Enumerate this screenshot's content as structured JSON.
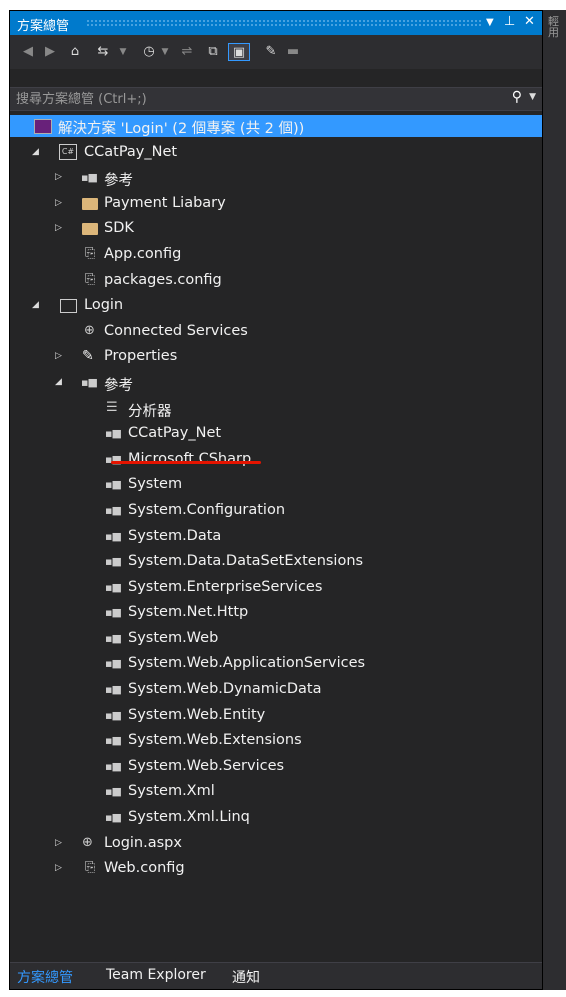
{
  "window": {
    "title": "方案總管"
  },
  "toolbar": {
    "icons": [
      "back-icon",
      "forward-icon",
      "home-icon",
      "sync-icon",
      "dropdown-icon",
      "history-icon",
      "dropdown-icon",
      "switch-view-icon",
      "collapse-all-icon",
      "show-all-files-icon",
      "properties-icon",
      "preview-icon"
    ]
  },
  "search": {
    "placeholder": "搜尋方案總管 (Ctrl+;)"
  },
  "right_strip": {
    "text": "輕用"
  },
  "tree": {
    "solution": "解決方案 'Login' (2 個專案 (共 2 個))",
    "items": [
      {
        "label": "CCatPay_Net"
      },
      {
        "label": "參考"
      },
      {
        "label": "Payment Liabary"
      },
      {
        "label": "SDK"
      },
      {
        "label": "App.config"
      },
      {
        "label": "packages.config"
      },
      {
        "label": "Login"
      },
      {
        "label": "Connected Services"
      },
      {
        "label": "Properties"
      },
      {
        "label": "參考"
      },
      {
        "label": "分析器"
      },
      {
        "label": "CCatPay_Net"
      },
      {
        "label": "Microsoft.CSharp"
      },
      {
        "label": "System"
      },
      {
        "label": "System.Configuration"
      },
      {
        "label": "System.Data"
      },
      {
        "label": "System.Data.DataSetExtensions"
      },
      {
        "label": "System.EnterpriseServices"
      },
      {
        "label": "System.Net.Http"
      },
      {
        "label": "System.Web"
      },
      {
        "label": "System.Web.ApplicationServices"
      },
      {
        "label": "System.Web.DynamicData"
      },
      {
        "label": "System.Web.Entity"
      },
      {
        "label": "System.Web.Extensions"
      },
      {
        "label": "System.Web.Services"
      },
      {
        "label": "System.Xml"
      },
      {
        "label": "System.Xml.Linq"
      },
      {
        "label": "Login.aspx"
      },
      {
        "label": "Web.config"
      }
    ]
  },
  "bottom_tabs": [
    "方案總管",
    "Team Explorer",
    "通知"
  ],
  "colors": {
    "accent": "#007acc",
    "selection": "#3399ff",
    "background": "#252526",
    "annotation": "#e51400"
  }
}
